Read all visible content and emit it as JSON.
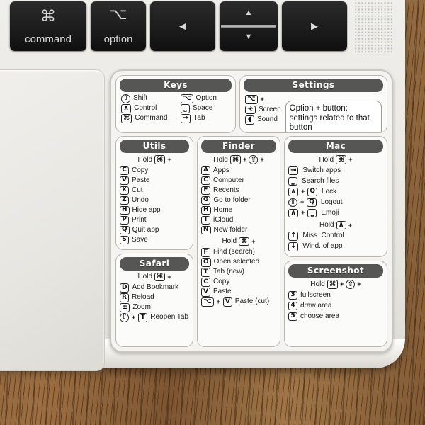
{
  "scene": {
    "description": "macOS keyboard shortcut reference sticker on a MacBook trackpad area",
    "desk_color": "#8a6038",
    "laptop_color": "#efeeea",
    "sticker_bg": "#f4f3ef",
    "header_color": "#565654"
  },
  "keyboard": {
    "keys": [
      {
        "name": "command-key",
        "glyph": "⌘",
        "label": "command"
      },
      {
        "name": "option-key",
        "glyph": "⌥",
        "label": "option"
      },
      {
        "name": "left-arrow-key",
        "glyph": "◀",
        "label": ""
      },
      {
        "name": "up-down-arrow-key",
        "glyph_up": "▲",
        "glyph_down": "▼",
        "label": ""
      },
      {
        "name": "right-arrow-key",
        "glyph": "▶",
        "label": ""
      }
    ],
    "speaker_label": "speaker-grille"
  },
  "sticker": {
    "sections": {
      "keys": {
        "title": "Keys",
        "left": [
          {
            "chip": "⇧",
            "shape": "round",
            "label": "Shift"
          },
          {
            "chip": "∧",
            "shape": "box",
            "label": "Control"
          },
          {
            "chip": "⌘",
            "shape": "box",
            "label": "Command"
          }
        ],
        "right": [
          {
            "chip": "⌥",
            "shape": "box",
            "label": "Option"
          },
          {
            "chip": "⎵",
            "shape": "box",
            "label": "Space"
          },
          {
            "chip": "⇥",
            "shape": "box",
            "label": "Tab"
          }
        ]
      },
      "settings": {
        "title": "Settings",
        "modifier": {
          "chip": "⌥",
          "plus": "+"
        },
        "items": [
          {
            "chip": "☀",
            "label": "Screen"
          },
          {
            "chip": "◖",
            "label": "Sound"
          }
        ],
        "note": "Option + button: settings related to that button"
      },
      "utils": {
        "title": "Utils",
        "hold": {
          "text": "Hold",
          "chips": [
            "⌘"
          ],
          "trailing": "+"
        },
        "items": [
          {
            "chip": "C",
            "label": "Copy"
          },
          {
            "chip": "V",
            "label": "Paste"
          },
          {
            "chip": "X",
            "label": "Cut"
          },
          {
            "chip": "Z",
            "label": "Undo"
          },
          {
            "chip": "H",
            "label": "Hide app"
          },
          {
            "chip": "P",
            "label": "Print"
          },
          {
            "chip": "Q",
            "label": "Quit app"
          },
          {
            "chip": "S",
            "label": "Save"
          }
        ]
      },
      "safari": {
        "title": "Safari",
        "hold": {
          "text": "Hold",
          "chips": [
            "⌘"
          ],
          "trailing": "+"
        },
        "items": [
          {
            "chip": "D",
            "label": "Add Bookmark"
          },
          {
            "chip": "R",
            "label": "Reload"
          },
          {
            "chip": "±",
            "label": "Zoom"
          },
          {
            "chip": "⇧",
            "chip2": "T",
            "label": "Reopen Tab"
          }
        ]
      },
      "finder": {
        "title": "Finder",
        "hold1": {
          "text": "Hold",
          "chips": [
            "⌘",
            "⇧"
          ],
          "trailing": "+"
        },
        "items1": [
          {
            "chip": "A",
            "label": "Apps"
          },
          {
            "chip": "C",
            "label": "Computer"
          },
          {
            "chip": "F",
            "label": "Recents"
          },
          {
            "chip": "G",
            "label": "Go to folder"
          },
          {
            "chip": "H",
            "label": "Home"
          },
          {
            "chip": "I",
            "label": "iCloud"
          },
          {
            "chip": "N",
            "label": "New folder"
          }
        ],
        "hold2": {
          "text": "Hold",
          "chips": [
            "⌘"
          ],
          "trailing": "+"
        },
        "items2": [
          {
            "chip": "F",
            "label": "Find (search)"
          },
          {
            "chip": "O",
            "label": "Open selected"
          },
          {
            "chip": "T",
            "label": "Tab (new)"
          },
          {
            "chip": "C",
            "label": "Copy"
          },
          {
            "chip": "V",
            "label": "Paste"
          },
          {
            "chip": "⌥",
            "chip2": "V",
            "label": "Paste (cut)"
          }
        ]
      },
      "mac": {
        "title": "Mac",
        "hold1": {
          "text": "Hold",
          "chips": [
            "⌘"
          ],
          "trailing": "+"
        },
        "items1": [
          {
            "chip": "⇥",
            "label": "Switch apps"
          },
          {
            "chip": "⎵",
            "label": "Search files"
          },
          {
            "chip": "∧",
            "chip2": "Q",
            "label": "Lock"
          },
          {
            "chip": "⇧",
            "chip2": "Q",
            "label": "Logout"
          },
          {
            "chip": "∧",
            "chip2": "⎵",
            "label": "Emoji"
          }
        ],
        "hold2": {
          "text": "Hold",
          "chips": [
            "∧"
          ],
          "trailing": "+"
        },
        "items2": [
          {
            "chip": "↑",
            "label": "Miss. Control"
          },
          {
            "chip": "↓",
            "label": "Wind. of app"
          }
        ]
      },
      "screenshot": {
        "title": "Screenshot",
        "hold": {
          "text": "Hold",
          "chips": [
            "⌘",
            "⇧"
          ],
          "trailing": "+"
        },
        "items": [
          {
            "chip": "3",
            "label": "fullscreen"
          },
          {
            "chip": "4",
            "label": "draw area"
          },
          {
            "chip": "5",
            "label": "choose area"
          }
        ]
      }
    }
  }
}
